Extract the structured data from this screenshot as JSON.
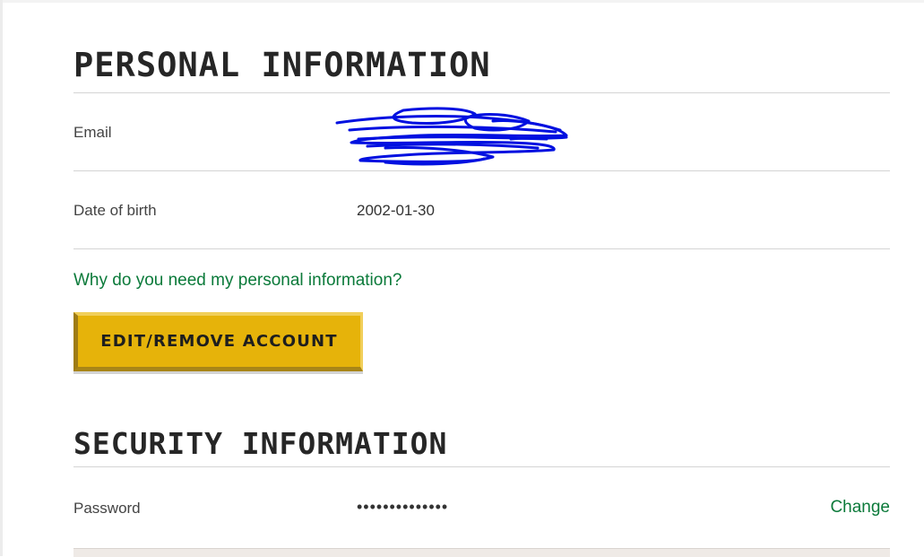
{
  "personal": {
    "title": "PERSONAL INFORMATION",
    "email_label": "Email",
    "email_value": "",
    "dob_label": "Date of birth",
    "dob_value": "2002-01-30",
    "why_link": "Why do you need my personal information?",
    "edit_button": "EDIT/REMOVE ACCOUNT"
  },
  "security": {
    "title": "SECURITY INFORMATION",
    "password_label": "Password",
    "password_value": "••••••••••••••",
    "change_link": "Change"
  },
  "colors": {
    "accent_link": "#0b7a3a",
    "button_fill": "#e6b30a",
    "redaction_scribble": "#0010e0"
  }
}
